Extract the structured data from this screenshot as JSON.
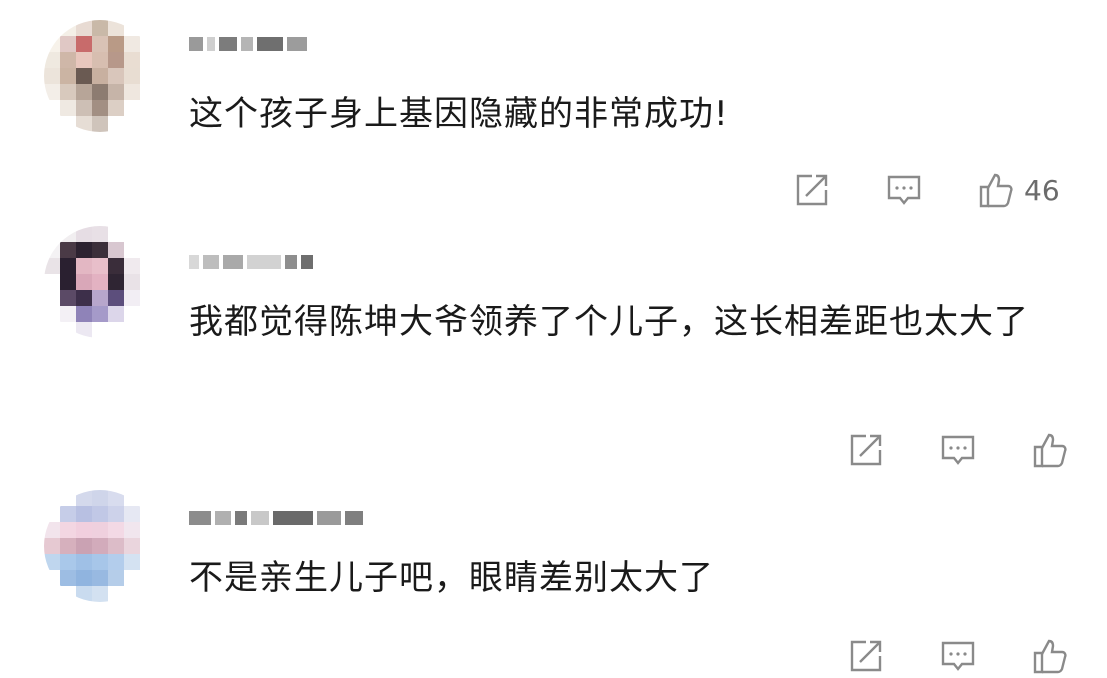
{
  "comments": [
    {
      "text": "这个孩子身上基因隐藏的非常成功!",
      "like_count": "46",
      "avatar_colors": [
        "#ffffff",
        "#f4efe7",
        "#e8dbd3",
        "#c9b9a8",
        "#ece3da",
        "#ffffff",
        "#ffffff",
        "#f7f2ea",
        "#e0c8c5",
        "#c86b6b",
        "#d9c2b5",
        "#b99a86",
        "#f0e9e2",
        "#ffffff",
        "#efe9e0",
        "#cfb7a8",
        "#e8c7bd",
        "#d7beb0",
        "#b7988a",
        "#e9ddd2",
        "#ffffff",
        "#ece4db",
        "#cbb4a3",
        "#6a5a52",
        "#c8b0a0",
        "#d9c6bb",
        "#e8ddd2",
        "#ffffff",
        "#f3eee8",
        "#d8c9bd",
        "#b7a598",
        "#8d7c71",
        "#c6b4a8",
        "#efe7df",
        "#ffffff",
        "#ffffff",
        "#efe9e2",
        "#cdbfb5",
        "#a28f83",
        "#dccfc5",
        "#ffffff",
        "#ffffff",
        "#ffffff",
        "#ffffff",
        "#e6ddd5",
        "#cfc4bb",
        "#ffffff",
        "#ffffff",
        "#ffffff"
      ]
    },
    {
      "text": "我都觉得陈坤大爷领养了个儿子，这长相差距也太大了",
      "like_count": "",
      "avatar_colors": [
        "#ffffff",
        "#f1eef0",
        "#e6dde4",
        "#e8e0e6",
        "#ffffff",
        "#ffffff",
        "#ffffff",
        "#f4f2f4",
        "#4a3a46",
        "#2c2230",
        "#3b2f3a",
        "#d8c7d0",
        "#ffffff",
        "#ffffff",
        "#e9e3e7",
        "#2a2030",
        "#e3b7c3",
        "#e8bfca",
        "#3a2d3a",
        "#f0eaee",
        "#ffffff",
        "#ffffff",
        "#2a2030",
        "#d9a7b8",
        "#e3b2c2",
        "#2f2533",
        "#e9e2e7",
        "#ffffff",
        "#ffffff",
        "#5b4a66",
        "#3d2f4a",
        "#b7a6cc",
        "#5c4e7c",
        "#f2eef4",
        "#ffffff",
        "#ffffff",
        "#f3f0f5",
        "#8f83b8",
        "#a59ac9",
        "#dcd6ea",
        "#ffffff",
        "#ffffff",
        "#ffffff",
        "#ffffff",
        "#ece8f2",
        "#ffffff",
        "#ffffff",
        "#ffffff",
        "#ffffff"
      ]
    },
    {
      "text": "不是亲生儿子吧，眼睛差别太大了",
      "like_count": "",
      "avatar_colors": [
        "#ffffff",
        "#ffffff",
        "#d4d9ec",
        "#cfd5ea",
        "#d8dcee",
        "#ffffff",
        "#ffffff",
        "#ffffff",
        "#c6cde8",
        "#b8c0e2",
        "#c1c8e6",
        "#cdd2ea",
        "#e6e8f3",
        "#ffffff",
        "#f2e4ec",
        "#f3d6e2",
        "#f1cfde",
        "#efd0de",
        "#f3d9e5",
        "#f1e6ee",
        "#ffffff",
        "#e6c9d2",
        "#d6b0bd",
        "#caa2b3",
        "#d2abbb",
        "#dcbcc8",
        "#ead5dd",
        "#ffffff",
        "#bfd6ee",
        "#a9c8ea",
        "#9fc0e6",
        "#a7c6e9",
        "#b3cdec",
        "#d4e2f2",
        "#ffffff",
        "#ffffff",
        "#9dbde3",
        "#90b4df",
        "#98b9e1",
        "#b5cde9",
        "#ffffff",
        "#ffffff",
        "#ffffff",
        "#ffffff",
        "#c9dbef",
        "#d3e1f1",
        "#ffffff",
        "#ffffff",
        "#ffffff"
      ]
    }
  ],
  "icons": {
    "share": "share-icon",
    "reply": "reply-icon",
    "like": "like-icon"
  },
  "colors": {
    "text": "#1a1a1a",
    "icon": "#8a8a8a"
  }
}
